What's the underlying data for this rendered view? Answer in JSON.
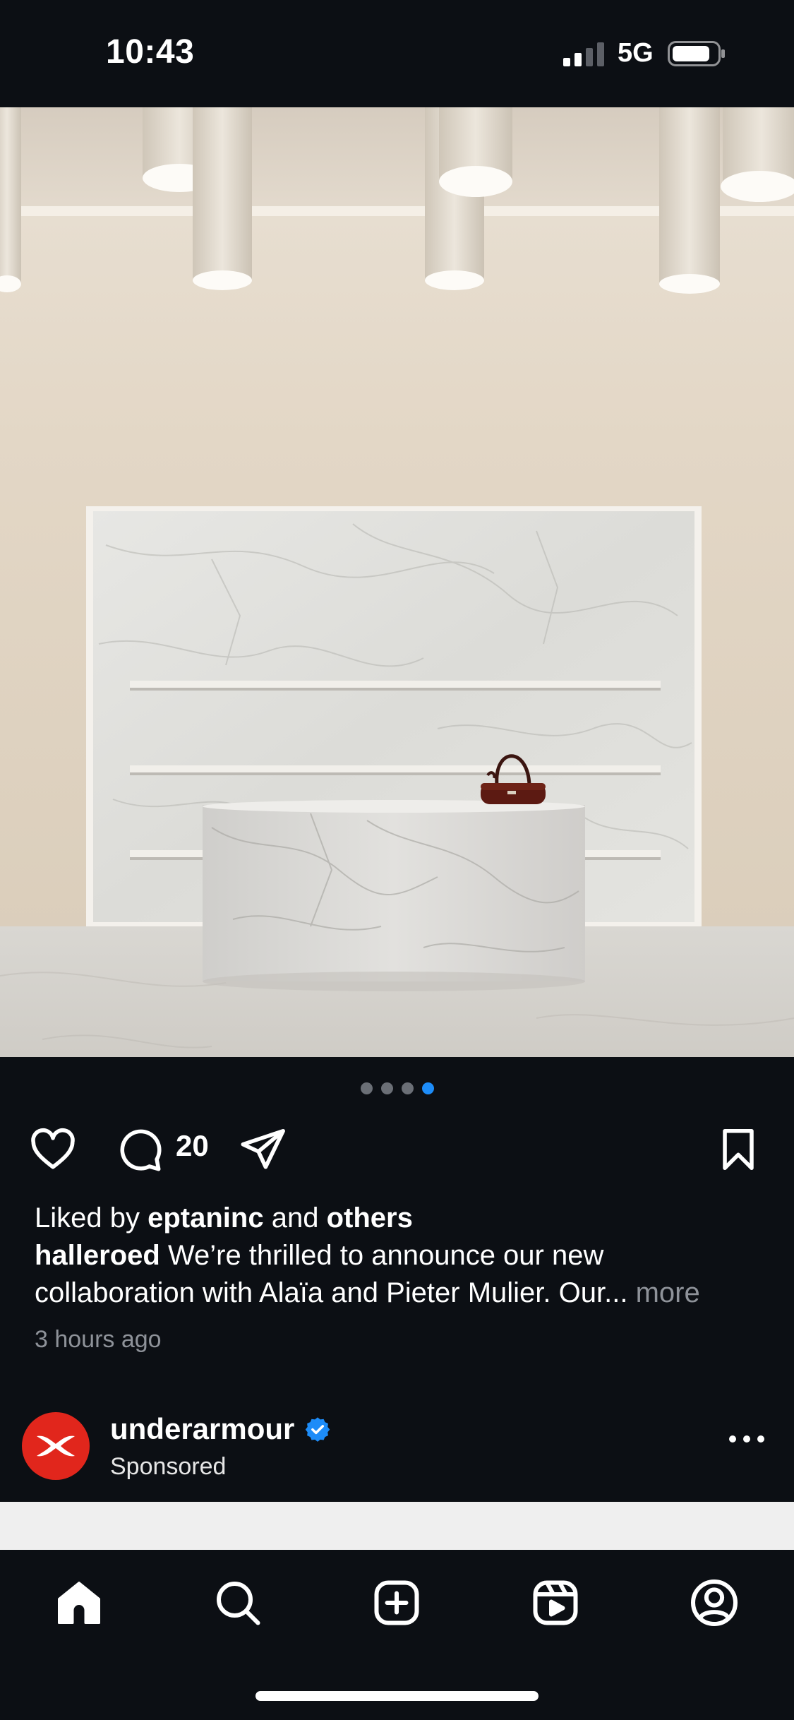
{
  "status_bar": {
    "time": "10:43",
    "network": "5G",
    "signal_icon": "cellular-signal-icon",
    "battery_icon": "battery-icon"
  },
  "post": {
    "image_description_icon": "photo",
    "carousel": {
      "total": 4,
      "active_index": 4
    },
    "actions": {
      "like_icon": "heart-icon",
      "comment_icon": "comment-bubble-icon",
      "comment_count": "20",
      "share_icon": "paper-plane-icon",
      "save_icon": "bookmark-icon"
    },
    "likes": {
      "prefix": "Liked by ",
      "user": "eptaninc",
      "middle": " and ",
      "suffix": "others"
    },
    "caption": {
      "username": "halleroed",
      "line1": " We’re thrilled to announce our new",
      "line2": "collaboration with Alaïa and Pieter Mulier. Our...",
      "more": " more"
    },
    "timestamp": "3 hours ago"
  },
  "sponsored_post": {
    "username": "underarmour",
    "subtitle": "Sponsored",
    "avatar_icon": "under-armour-logo",
    "verified_icon": "verified-badge-icon",
    "more_icon": "more-options-icon"
  },
  "bottom_nav": {
    "items": [
      "home-icon",
      "search-icon",
      "create-icon",
      "reels-icon",
      "profile-icon"
    ]
  },
  "colors": {
    "background": "#0c0f14",
    "accent_blue": "#1d8cf8",
    "brand_red": "#e1261c",
    "muted_text": "#8e9299"
  }
}
